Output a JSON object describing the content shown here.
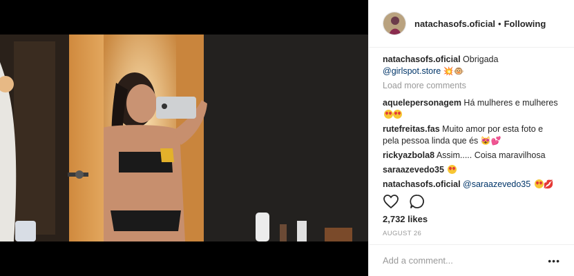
{
  "post": {
    "username": "natachasofs.oficial",
    "separator": "•",
    "follow_status": "Following"
  },
  "caption": {
    "username": "natachasofs.oficial",
    "text": "Obrigada",
    "mention": "@girlspot.store",
    "emoji": "💥🐵"
  },
  "load_more": "Load more comments",
  "comments": [
    {
      "user": "aquelepersonagem",
      "text": "Há mulheres e mulheres",
      "emoji": "heart-eyes x2"
    },
    {
      "user": "rutefreitas.fas",
      "text": "Muito amor por esta foto e pela pessoa linda que és",
      "emoji": "😻💕"
    },
    {
      "user": "rickyazbola8",
      "text": "Assim..... Coisa maravilhosa"
    },
    {
      "user": "saraazevedo35",
      "text": "",
      "emoji": "heart-eyes"
    },
    {
      "user": "natachasofs.oficial",
      "mention": "@saraazevedo35",
      "emoji": "heart-eyes + 💋"
    }
  ],
  "likes": "2,732 likes",
  "date": "AUGUST 26",
  "add_comment": {
    "placeholder": "Add a comment..."
  },
  "more_label": "•••",
  "icons": [
    "heart-icon",
    "comment-icon",
    "more-options-icon"
  ]
}
